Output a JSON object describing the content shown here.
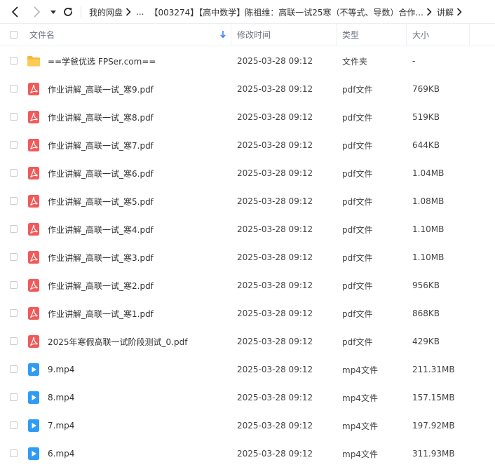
{
  "breadcrumb": {
    "items": [
      "我的网盘",
      "...",
      "【003274】【高中数学】陈祖维：高联一试25寒（不等式、导数）合作...",
      "讲解"
    ]
  },
  "columns": {
    "name": "文件名",
    "modified": "修改时间",
    "type": "类型",
    "size": "大小"
  },
  "colors": {
    "folder": "#f6b73c",
    "pdf": "#f05a5a",
    "video": "#2f9bf5"
  },
  "files": [
    {
      "icon": "folder-icon",
      "name": "==学爸优选 FPSer.com==",
      "modified": "2025-03-28 09:12",
      "type": "文件夹",
      "size": "-"
    },
    {
      "icon": "pdf-icon",
      "name": "作业讲解_高联一试_寒9.pdf",
      "modified": "2025-03-28 09:12",
      "type": "pdf文件",
      "size": "769KB"
    },
    {
      "icon": "pdf-icon",
      "name": "作业讲解_高联一试_寒8.pdf",
      "modified": "2025-03-28 09:12",
      "type": "pdf文件",
      "size": "519KB"
    },
    {
      "icon": "pdf-icon",
      "name": "作业讲解_高联一试_寒7.pdf",
      "modified": "2025-03-28 09:12",
      "type": "pdf文件",
      "size": "644KB"
    },
    {
      "icon": "pdf-icon",
      "name": "作业讲解_高联一试_寒6.pdf",
      "modified": "2025-03-28 09:12",
      "type": "pdf文件",
      "size": "1.04MB"
    },
    {
      "icon": "pdf-icon",
      "name": "作业讲解_高联一试_寒5.pdf",
      "modified": "2025-03-28 09:12",
      "type": "pdf文件",
      "size": "1.08MB"
    },
    {
      "icon": "pdf-icon",
      "name": "作业讲解_高联一试_寒4.pdf",
      "modified": "2025-03-28 09:12",
      "type": "pdf文件",
      "size": "1.10MB"
    },
    {
      "icon": "pdf-icon",
      "name": "作业讲解_高联一试_寒3.pdf",
      "modified": "2025-03-28 09:12",
      "type": "pdf文件",
      "size": "1.10MB"
    },
    {
      "icon": "pdf-icon",
      "name": "作业讲解_高联一试_寒2.pdf",
      "modified": "2025-03-28 09:12",
      "type": "pdf文件",
      "size": "956KB"
    },
    {
      "icon": "pdf-icon",
      "name": "作业讲解_高联一试_寒1.pdf",
      "modified": "2025-03-28 09:12",
      "type": "pdf文件",
      "size": "868KB"
    },
    {
      "icon": "pdf-icon",
      "name": "2025年寒假高联一试阶段测试_0.pdf",
      "modified": "2025-03-28 09:12",
      "type": "pdf文件",
      "size": "429KB"
    },
    {
      "icon": "video-icon",
      "name": "9.mp4",
      "modified": "2025-03-28 09:12",
      "type": "mp4文件",
      "size": "211.31MB"
    },
    {
      "icon": "video-icon",
      "name": "8.mp4",
      "modified": "2025-03-28 09:12",
      "type": "mp4文件",
      "size": "157.15MB"
    },
    {
      "icon": "video-icon",
      "name": "7.mp4",
      "modified": "2025-03-28 09:12",
      "type": "mp4文件",
      "size": "197.92MB"
    },
    {
      "icon": "video-icon",
      "name": "6.mp4",
      "modified": "2025-03-28 09:12",
      "type": "mp4文件",
      "size": "311.93MB"
    }
  ]
}
